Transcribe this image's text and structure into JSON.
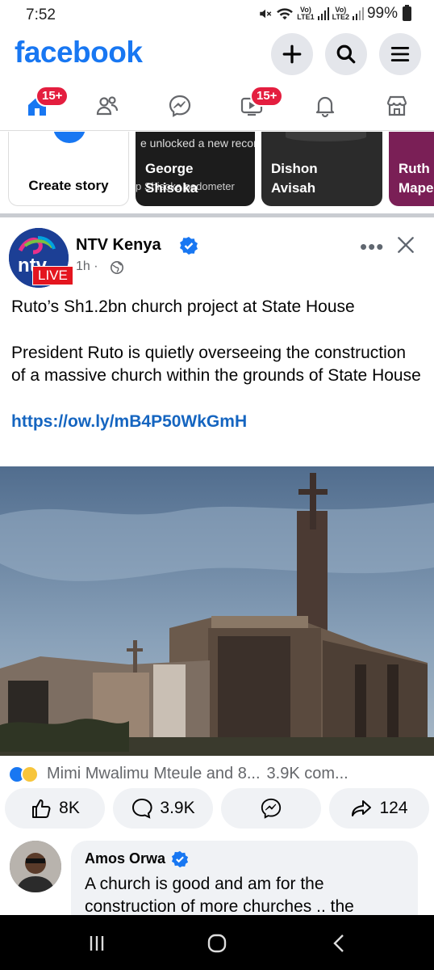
{
  "status_bar": {
    "time": "7:52",
    "battery": "99%",
    "sim1": "Vo)\nLTE1",
    "sim2": "Vo)\nLTE2"
  },
  "header": {
    "logo": "facebook",
    "icons": [
      "plus-icon",
      "search-icon",
      "menu-icon"
    ]
  },
  "nav": {
    "home_badge": "15+",
    "video_badge": "15+",
    "items": [
      "home-icon",
      "friends-icon",
      "messenger-icon",
      "video-icon",
      "notifications-icon",
      "marketplace-icon"
    ]
  },
  "stories": {
    "create_label": "Create story",
    "items": [
      {
        "overlay": "e unlocked a new record",
        "overlay2": "p Shisoka pedometer",
        "name_line1": "George",
        "name_line2": "Shisoka"
      },
      {
        "name_line1": "Dishon",
        "name_line2": "Avisah"
      },
      {
        "name_line1": "Ruth",
        "name_line2": "Mape"
      }
    ]
  },
  "post": {
    "author": "NTV Kenya",
    "live": "LIVE",
    "time": "1h",
    "separator": "·",
    "more": "•••",
    "headline": "Ruto’s Sh1.2bn church project at State House",
    "body": "President Ruto is quietly overseeing the construction of a massive church within the grounds of State House",
    "link": "https://ow.ly/mB4P50WkGmH",
    "reactions_text": "Mimi Mwalimu Mteule and 8...",
    "comments_text": "3.9K com...",
    "likes": "8K",
    "comments": "3.9K",
    "shares": "124"
  },
  "comment": {
    "author": "Amos Orwa",
    "text": "A church is good and am for the construction of more churches .. the"
  },
  "colors": {
    "brand": "#1877f2",
    "badge": "#e41e3f",
    "link": "#1565c0"
  }
}
